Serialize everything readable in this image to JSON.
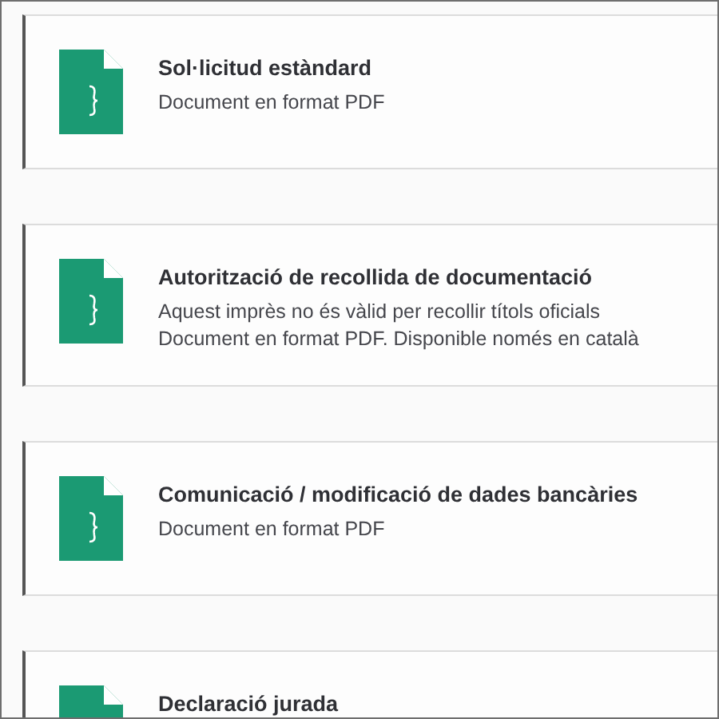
{
  "documents": [
    {
      "title": "Sol·licitud estàndard",
      "lines": [
        "Document en format PDF"
      ]
    },
    {
      "title": "Autorització de recollida de documentació",
      "lines": [
        "Aquest imprès no és vàlid per recollir títols oficials",
        "Document en format PDF. Disponible només en català"
      ]
    },
    {
      "title": "Comunicació / modificació de dades bancàries",
      "lines": [
        "Document en format PDF"
      ]
    },
    {
      "title": "Declaració jurada"
    }
  ]
}
